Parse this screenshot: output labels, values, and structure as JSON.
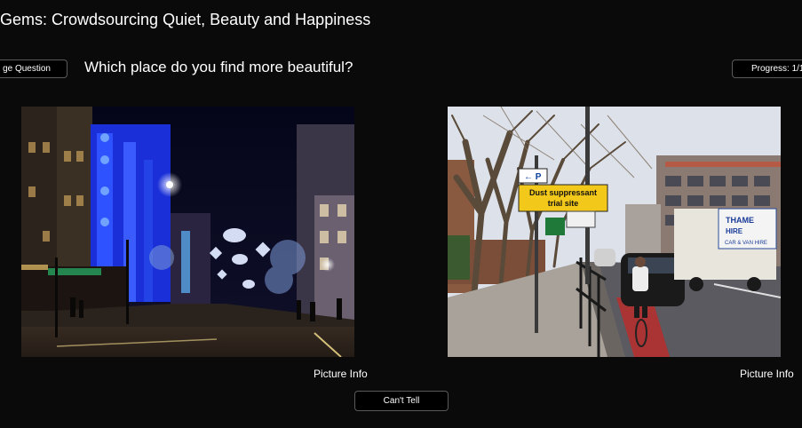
{
  "app": {
    "title": "nGems: Crowdsourcing Quiet, Beauty and Happiness"
  },
  "toolbar": {
    "change_question_label": "ge Question",
    "progress_label": "Progress: 1/1"
  },
  "question": {
    "text": "Which place do you find more beautiful?"
  },
  "photos": [
    {
      "picture_info_label": "Picture Info"
    },
    {
      "picture_info_label": "Picture Info",
      "sign_line1": "Dust suppressant",
      "sign_line2": "trial site",
      "truck_text1": "THAME",
      "truck_text2": "HIRE",
      "truck_text3": "CAR & VAN HIRE"
    }
  ],
  "actions": {
    "cant_tell_label": "Can't Tell"
  },
  "colors": {
    "background": "#0a0a0a",
    "button_background": "#000000",
    "button_border": "#5a5a5a",
    "text": "#ffffff"
  }
}
